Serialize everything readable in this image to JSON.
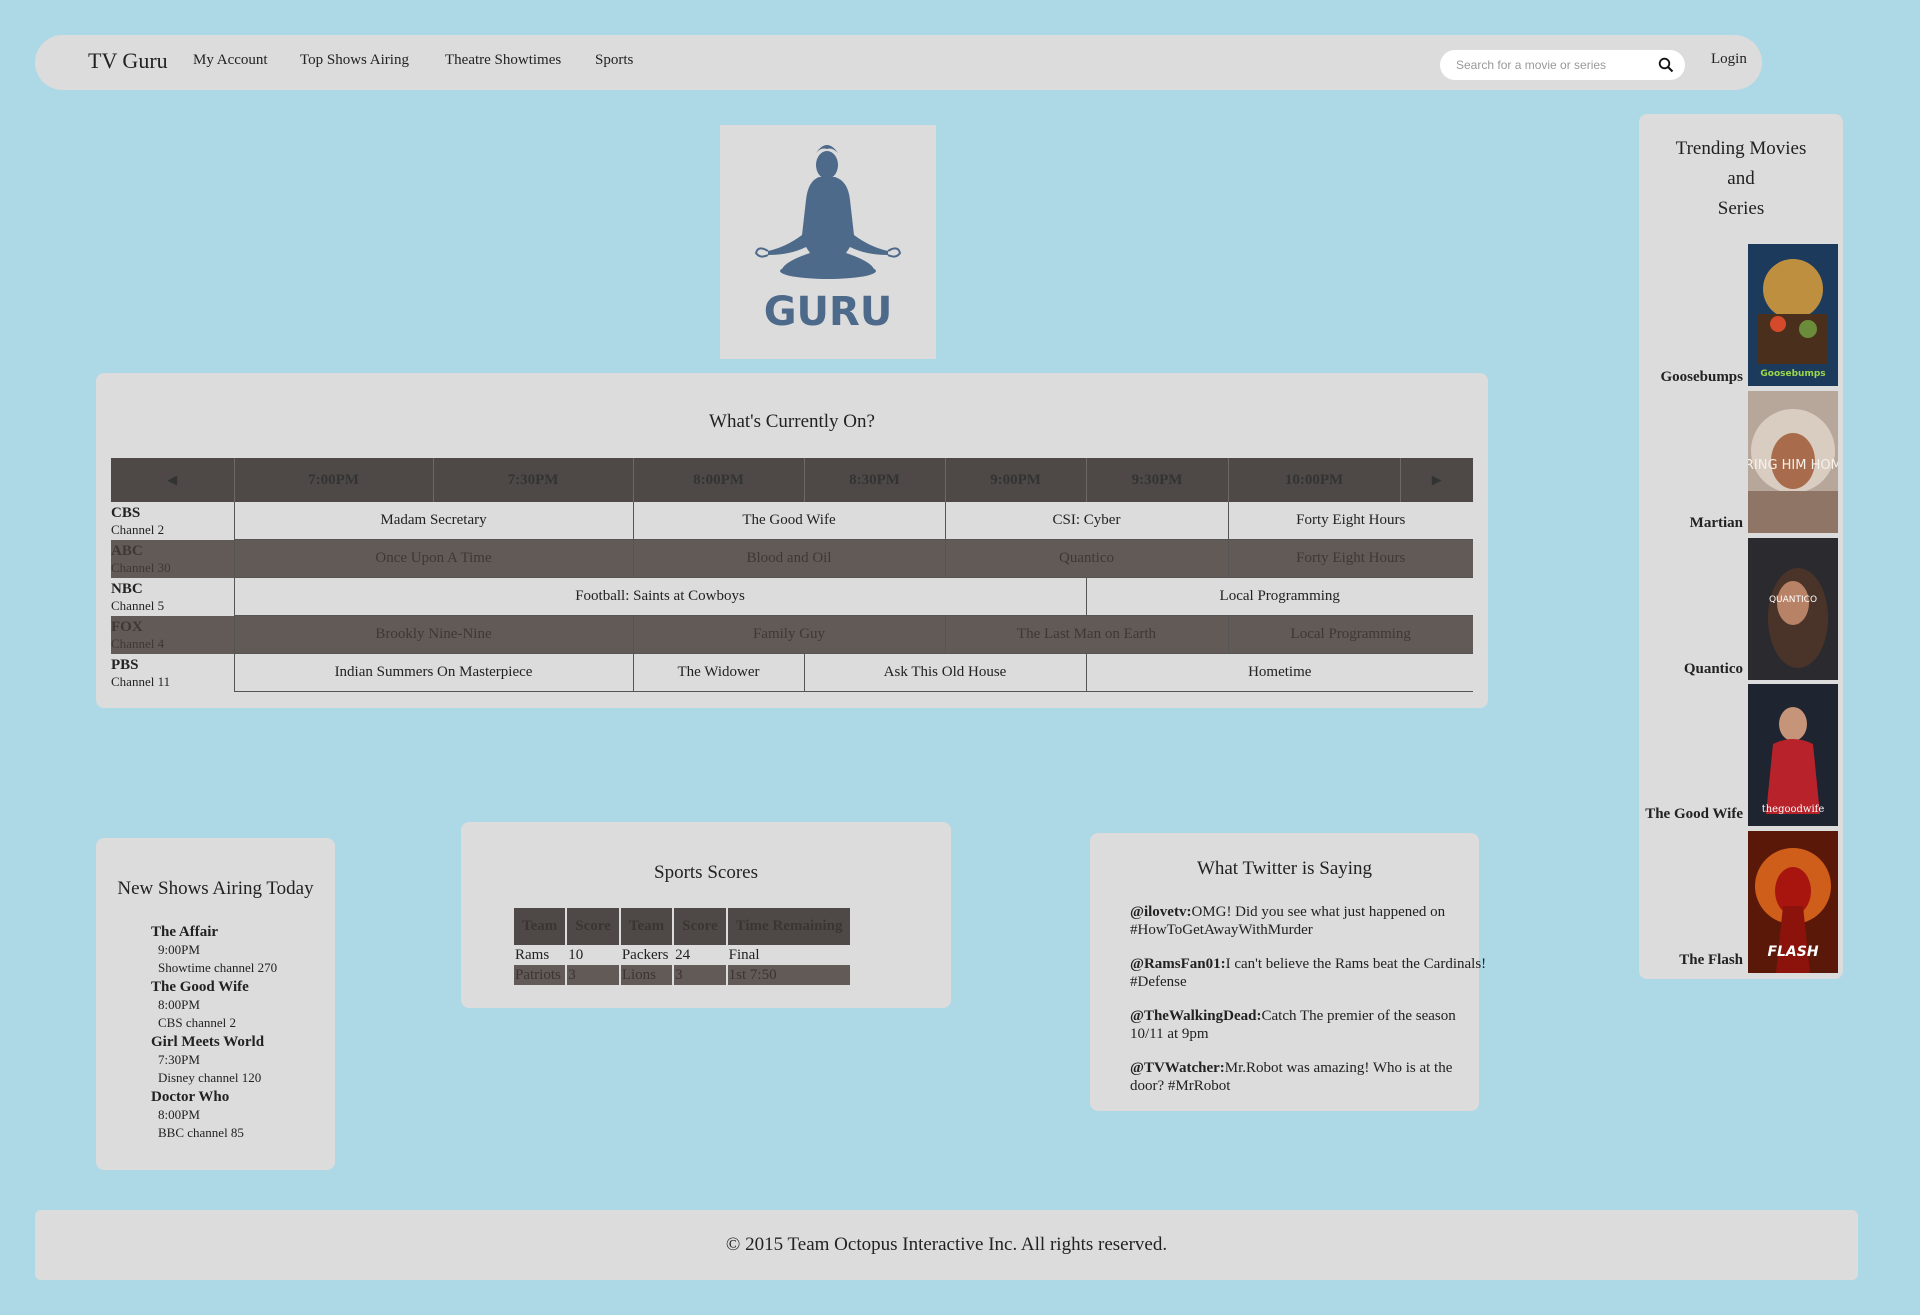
{
  "nav": {
    "brand": "TV Guru",
    "links": [
      "My Account",
      "Top Shows Airing",
      "Theatre Showtimes",
      "Sports"
    ],
    "search_placeholder": "Search for a movie or series",
    "login": "Login"
  },
  "logo": {
    "text": "GURU"
  },
  "schedule": {
    "title": "What's Currently On?",
    "prev_arrow": "◀",
    "next_arrow": "▶",
    "times": [
      "7:00PM",
      "7:30PM",
      "8:00PM",
      "8:30PM",
      "9:00PM",
      "9:30PM",
      "10:00PM"
    ],
    "channels": [
      {
        "name": "CBS",
        "number": "Channel 2",
        "shows": [
          "Madam Secretary",
          "The Good Wife",
          "CSI: Cyber",
          "Forty Eight Hours"
        ]
      },
      {
        "name": "ABC",
        "number": "Channel 30",
        "shows": [
          "Once Upon A Time",
          "Blood and Oil",
          "Quantico",
          "Forty Eight Hours"
        ]
      },
      {
        "name": "NBC",
        "number": "Channel 5",
        "shows": [
          "Football: Saints at Cowboys",
          "Local Programming"
        ]
      },
      {
        "name": "FOX",
        "number": "Channel 4",
        "shows": [
          "Brookly Nine-Nine",
          "Family Guy",
          "The Last Man on Earth",
          "Local Programming"
        ]
      },
      {
        "name": "PBS",
        "number": "Channel 11",
        "shows": [
          "Indian Summers On Masterpiece",
          "The Widower",
          "Ask This Old House",
          "Hometime"
        ]
      }
    ]
  },
  "trending": {
    "title_lines": [
      "Trending Movies",
      "and",
      "Series"
    ],
    "items": [
      {
        "label": "Goosebumps",
        "poster_text": "Goosebumps"
      },
      {
        "label": "Martian",
        "poster_text": "BRING HIM HOME"
      },
      {
        "label": "Quantico",
        "poster_text": "QUANTICO"
      },
      {
        "label": "The Good Wife",
        "poster_text": "thegoodwife"
      },
      {
        "label": "The Flash",
        "poster_text": "FLASH"
      }
    ]
  },
  "new_shows": {
    "title": "New Shows Airing Today",
    "items": [
      {
        "title": "The Affair",
        "time": "9:00PM",
        "channel": "Showtime channel 270"
      },
      {
        "title": "The Good Wife",
        "time": "8:00PM",
        "channel": "CBS channel 2"
      },
      {
        "title": "Girl Meets World",
        "time": "7:30PM",
        "channel": "Disney channel 120"
      },
      {
        "title": "Doctor Who",
        "time": "8:00PM",
        "channel": "BBC channel 85"
      }
    ]
  },
  "sports": {
    "title": "Sports Scores",
    "headers": [
      "Team",
      "Score",
      "Team",
      "Score",
      "Time Remaining"
    ],
    "rows": [
      [
        "Rams",
        "10",
        "Packers",
        "24",
        "Final"
      ],
      [
        "Patriots",
        "3",
        "Lions",
        "3",
        "1st 7:50"
      ]
    ]
  },
  "twitter": {
    "title": "What Twitter is Saying",
    "tweets": [
      {
        "handle": "@ilovetv:",
        "text": "OMG! Did you see what just happened on #HowToGetAwayWithMurder"
      },
      {
        "handle": "@RamsFan01:",
        "text": "I can't believe the Rams beat the Cardinals! #Defense"
      },
      {
        "handle": "@TheWalkingDead:",
        "text": "Catch The premier of the season 10/11 at 9pm"
      },
      {
        "handle": "@TVWatcher:",
        "text": "Mr.Robot was amazing! Who is at the door? #MrRobot"
      }
    ]
  },
  "footer": {
    "text": "© 2015 Team Octopus Interactive Inc. All rights reserved."
  },
  "colors": {
    "page_bg": "#add8e6",
    "panel_bg": "#dcdcdc",
    "table_header": "#4e4946",
    "dark_row": "#625a57",
    "logo_blue": "#4e6a8a"
  }
}
